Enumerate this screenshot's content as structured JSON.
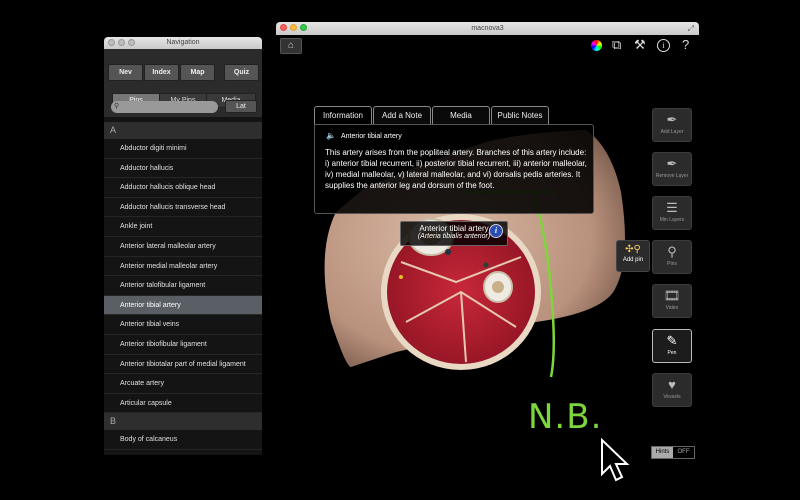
{
  "nav_window": {
    "title": "Navigation",
    "buttons": [
      "Nev",
      "Index",
      "Map",
      "Quiz"
    ],
    "segments": [
      "Pins",
      "My Pins",
      "Media"
    ],
    "active_segment": "Pins",
    "search_placeholder": "",
    "lat_label": "Lat",
    "section_a": "A",
    "section_b": "B",
    "items_a": [
      "Abductor digiti minimi",
      "Adductor hallucis",
      "Adductor hallucis oblique head",
      "Adductor hallucis transverse head",
      "Ankle joint",
      "Anterior lateral malleolar artery",
      "Anterior medial malleolar artery",
      "Anterior talofibular ligament",
      "Anterior tibial artery",
      "Anterior tibial veins",
      "Anterior tibiofibular ligament",
      "Anterior tibiotalar part of medial ligament",
      "Arcuate artery",
      "Articular capsule"
    ],
    "items_b": [
      "Body of calcaneus"
    ],
    "selected_item": "Anterior tibial artery"
  },
  "main_window": {
    "title": "macnova3",
    "tabs": [
      "Information",
      "Add a Note",
      "Media",
      "Public Notes"
    ],
    "active_tab": "Information",
    "info_title": "Anterior tibial artery",
    "info_body": "This artery arises from the popliteal artery. Branches of this artery include: i) anterior tibial recurrent, ii) posterior tibial recurrent, iii) anterior malleolar, iv) medial malleolar, v) lateral malleolar, and vi) dorsalis pedis arteries. It supplies the anterior leg and dorsum of the foot.",
    "label_name": "Anterior tibial artery",
    "label_latin": "(Arteria tibialis anterior)",
    "tools": [
      {
        "icon": "pen-icon",
        "label": "Add Layer"
      },
      {
        "icon": "pen-icon",
        "label": "Remove Layer"
      },
      {
        "icon": "layers-icon",
        "label": "Min Layers"
      },
      {
        "icon": "pin-icon",
        "label": "Pins"
      },
      {
        "icon": "film-icon",
        "label": "Video"
      },
      {
        "icon": "pencil-icon",
        "label": "Pen"
      },
      {
        "icon": "heart-icon",
        "label": "Vessels"
      }
    ],
    "add_pin_label": "Add pin",
    "hints_label": "Hints",
    "hints_off": "OFF"
  },
  "annotation": {
    "handwritten_text": "N.B.",
    "color": "#7dd63a"
  }
}
